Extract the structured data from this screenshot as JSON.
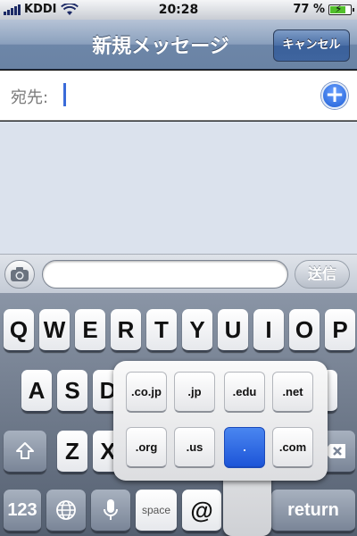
{
  "status": {
    "carrier": "KDDI",
    "time": "20:28",
    "battery": "77 %",
    "battery_level": 0.77
  },
  "nav": {
    "title": "新規メッセージ",
    "cancel": "キャンセル"
  },
  "recipient": {
    "label": "宛先:",
    "value": ""
  },
  "compose": {
    "text": "",
    "send": "送信"
  },
  "keyboard": {
    "row1": [
      "Q",
      "W",
      "E",
      "R",
      "T",
      "Y",
      "U",
      "I",
      "O",
      "P"
    ],
    "row2": [
      "A",
      "S",
      "D"
    ],
    "row3": [
      "Z",
      "X"
    ],
    "bottom": {
      "numbers": "123",
      "space": "space",
      "at": "@",
      "return": "return"
    }
  },
  "popup": {
    "options": [
      ".co.jp",
      ".jp",
      ".edu",
      ".net",
      ".org",
      ".us",
      ".",
      ".com"
    ],
    "selected": "."
  },
  "colors": {
    "accent": "#1d55d8",
    "nav": "#6d86a8"
  }
}
